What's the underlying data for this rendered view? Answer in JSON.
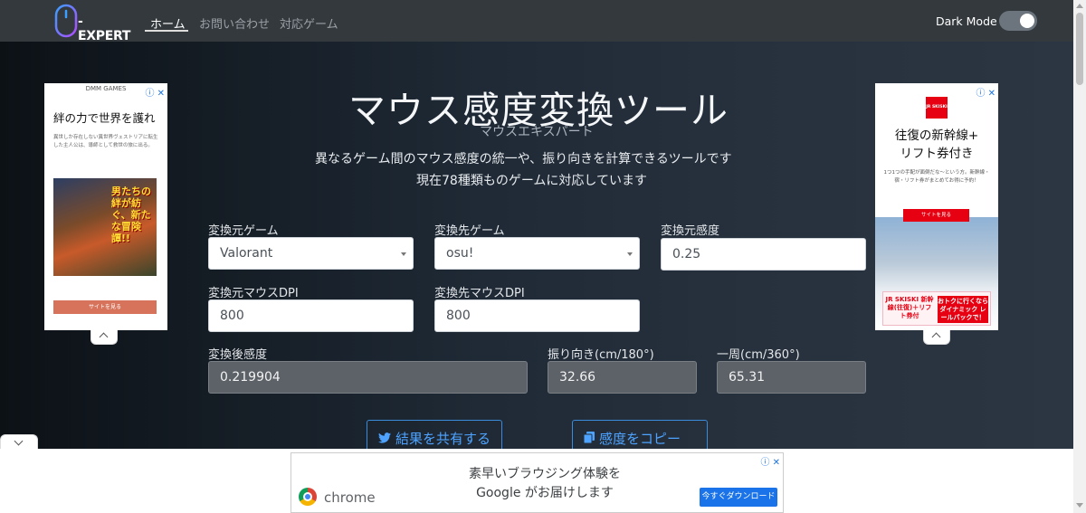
{
  "navbar": {
    "logo_text": "-EXPERT",
    "items": [
      {
        "label": "ホーム",
        "active": true
      },
      {
        "label": "お問い合わせ",
        "active": false
      },
      {
        "label": "対応ゲーム",
        "active": false
      }
    ],
    "dark_mode_label": "Dark Mode",
    "dark_mode_on": true
  },
  "hero": {
    "title": "マウス感度変換ツール",
    "subtitle": "マウスエキスパート",
    "desc_line1": "異なるゲーム間のマウス感度の統一や、振り向きを計算できるツールです",
    "desc_line2": "現在78種類ものゲームに対応しています"
  },
  "form": {
    "source_game_label": "変換元ゲーム",
    "source_game_value": "Valorant",
    "target_game_label": "変換先ゲーム",
    "target_game_value": "osu!",
    "source_sens_label": "変換元感度",
    "source_sens_value": "0.25",
    "source_dpi_label": "変換元マウスDPI",
    "source_dpi_value": "800",
    "target_dpi_label": "変換先マウスDPI",
    "target_dpi_value": "800",
    "result_label": "変換後感度",
    "result_value": "0.219904",
    "turn180_label": "振り向き(cm/180°)",
    "turn180_value": "32.66",
    "turn360_label": "一周(cm/360°)",
    "turn360_value": "65.31"
  },
  "actions": {
    "share_label": "結果を共有する",
    "copy_label": "感度をコピー"
  },
  "ads": {
    "left": {
      "brand": "DMM GAMES",
      "title": "絆の力で世界を護れ",
      "body": "異世しか存在しない異世界ヴェストリアに転生した主人公は、導師として救世の旅に出る。",
      "image_text": "男たちの絆が紡ぐ、新たな冒険譚!!",
      "button": "サイトを見る"
    },
    "right": {
      "logo": "JR SKISKI",
      "title_line1": "往復の新幹線+",
      "title_line2": "リフト券付き",
      "body": "1つ1つの手配が面倒だな〜という方。新幹線・宿・リフト券がまとめてお得に予約！",
      "button": "サイトを見る",
      "panel_left": "JR SKISKI 新幹線(往復)＋リフト券付",
      "panel_right": "おトクに行くなら ダイナミック レールパックで！"
    },
    "bottom": {
      "brand": "chrome",
      "headline_line1": "素早いブラウジング体験を",
      "headline_line2": "Google がお届けします",
      "cta": "今すぐダウンロード"
    },
    "close_glyph": "ⓘ ✕"
  },
  "colors": {
    "navbar_bg": "#34393e",
    "accent": "#4da3ff",
    "readonly_bg": "#5d6268"
  }
}
